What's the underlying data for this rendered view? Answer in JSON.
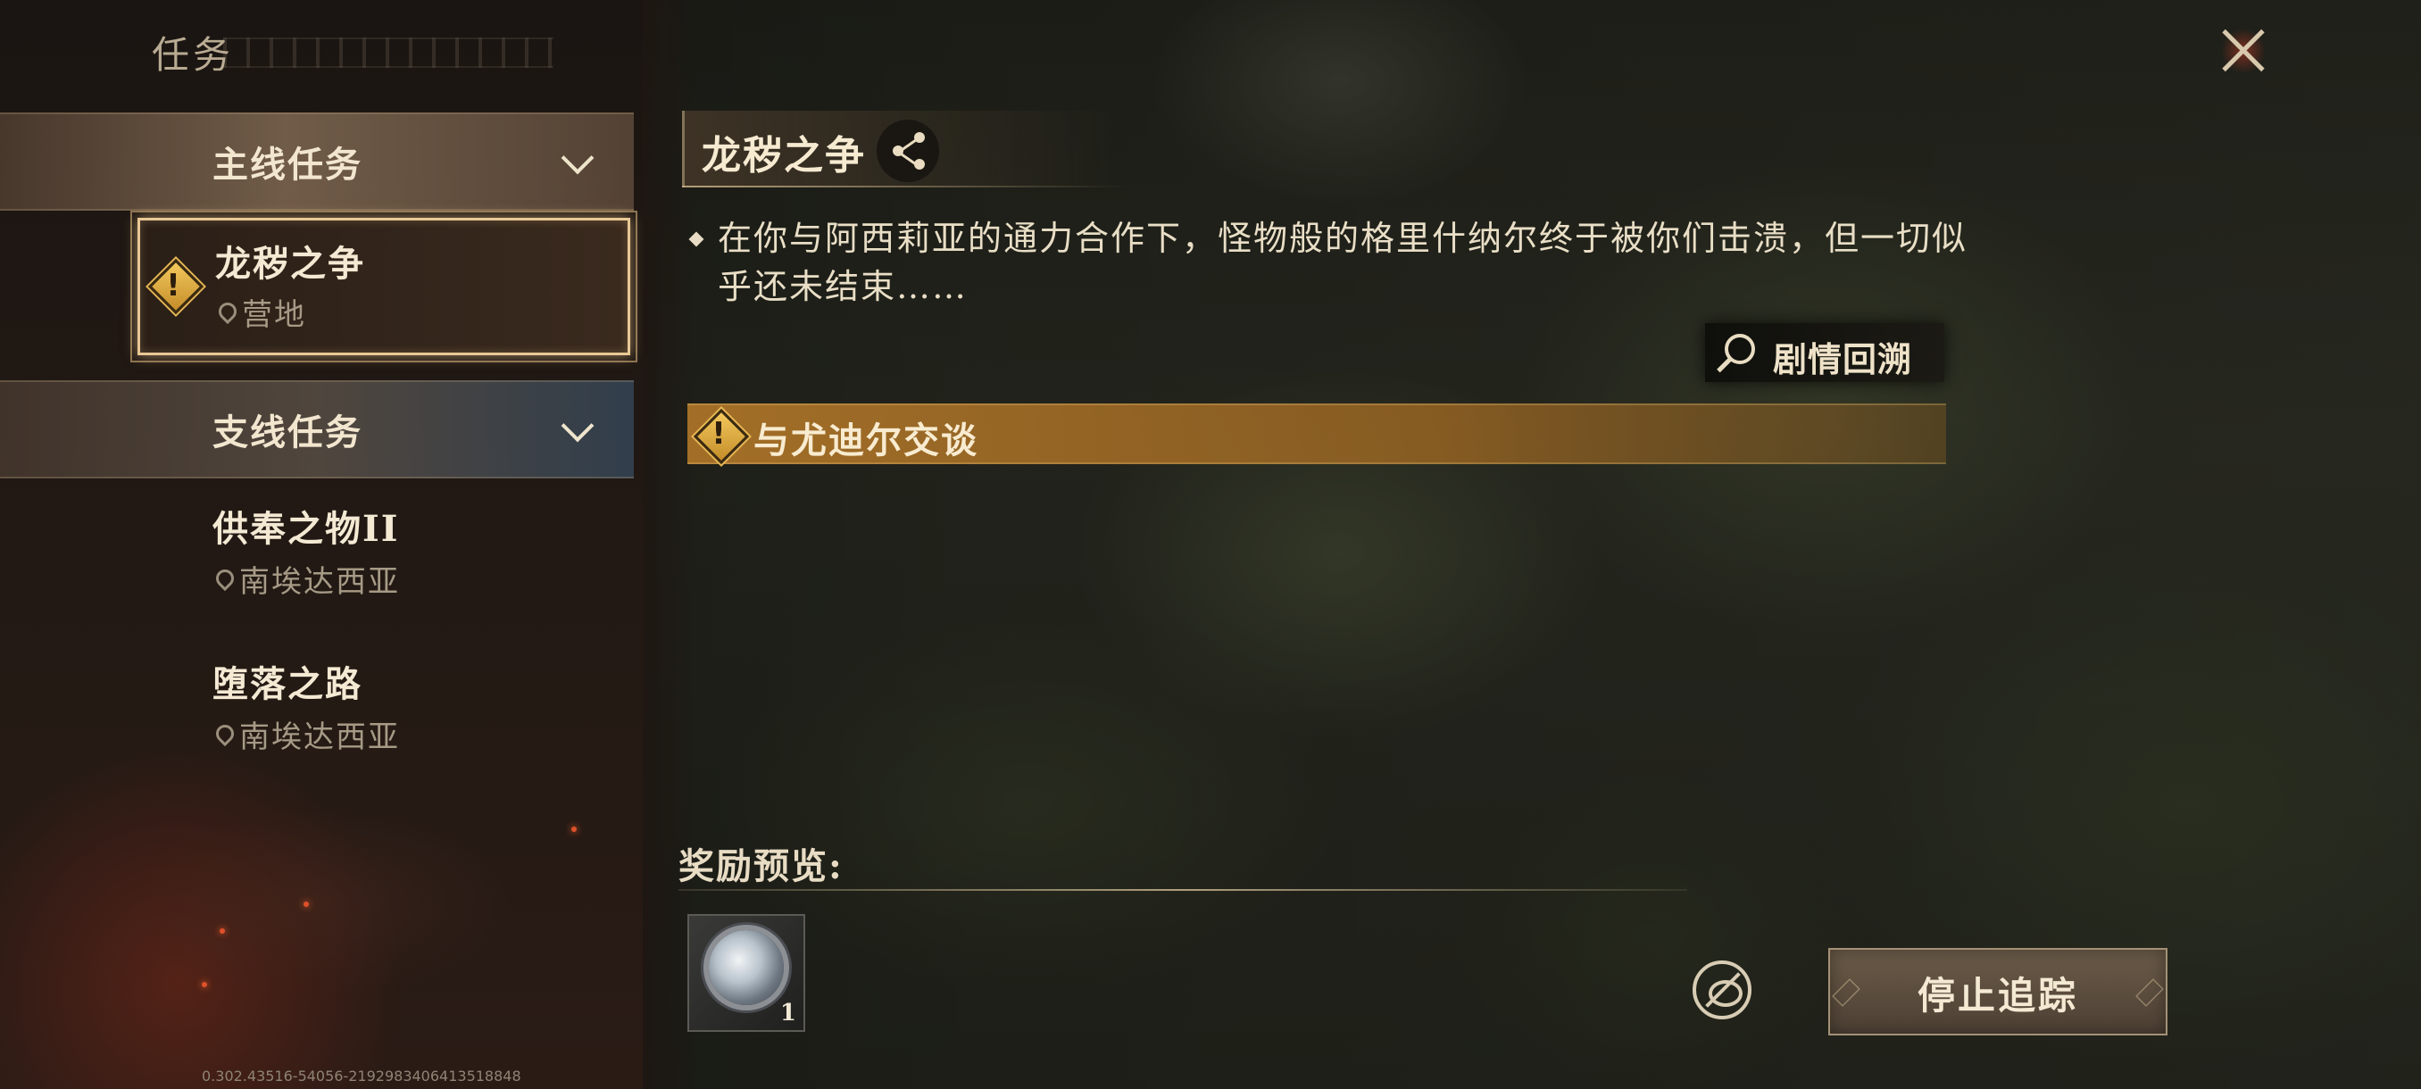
{
  "panel": {
    "title": "任务"
  },
  "categories": {
    "main": {
      "label": "主线任务"
    },
    "side": {
      "label": "支线任务"
    }
  },
  "quests": {
    "main": [
      {
        "name": "龙秽之争",
        "location": "营地",
        "selected": true,
        "icon": "warning-diamond-icon"
      }
    ],
    "side": [
      {
        "name": "供奉之物II",
        "location": "南埃达西亚"
      },
      {
        "name": "堕落之路",
        "location": "南埃达西亚"
      }
    ]
  },
  "detail": {
    "title": "龙秽之争",
    "description": "在你与阿西莉亚的通力合作下，怪物般的格里什纳尔终于被你们击溃，但一切似乎还未结束……",
    "recap_label": "剧情回溯",
    "objective": "与尤迪尔交谈",
    "reward_title": "奖励预览:",
    "rewards": [
      {
        "icon": "silver-orb-item-icon",
        "count": "1"
      }
    ],
    "stop_tracking_label": "停止追踪"
  },
  "footer": {
    "version": "0.302.43516-54056-2192983406413518848"
  },
  "colors": {
    "accent_gold": "#c48d2a",
    "selected_border": "#e8c895",
    "objective_bar": "#aa7328"
  }
}
